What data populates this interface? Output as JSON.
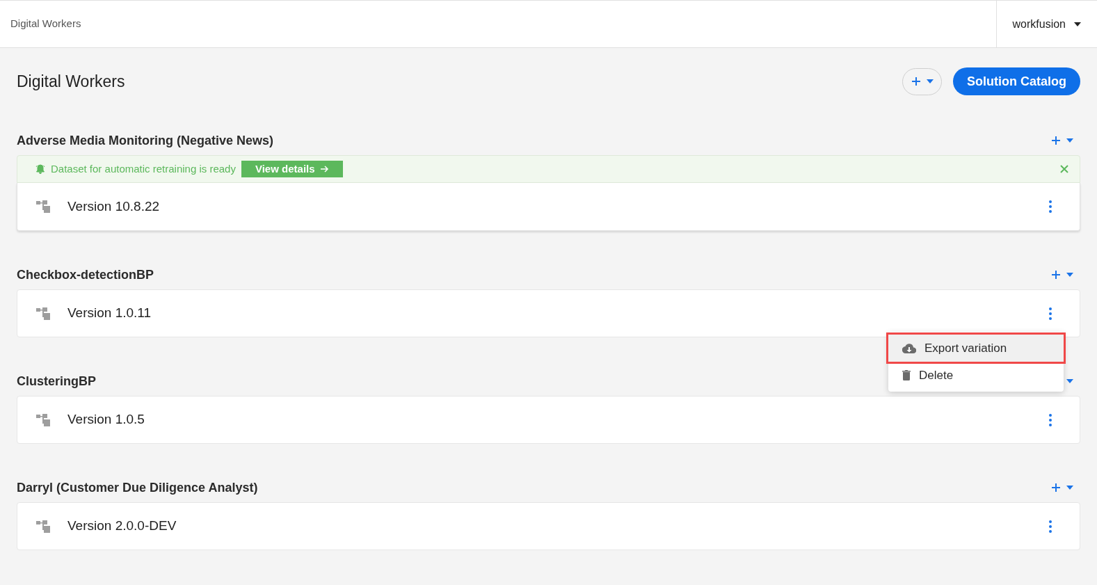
{
  "header": {
    "breadcrumb": "Digital Workers",
    "account": "workfusion"
  },
  "page": {
    "title": "Digital Workers",
    "catalog_button": "Solution Catalog"
  },
  "groups": [
    {
      "name": "Adverse Media Monitoring (Negative News)",
      "banner": {
        "message": "Dataset for automatic retraining is ready",
        "action": "View details"
      },
      "versions": [
        {
          "label": "Version 10.8.22",
          "menu_open": false
        }
      ]
    },
    {
      "name": "Checkbox-detectionBP",
      "versions": [
        {
          "label": "Version 1.0.11",
          "menu_open": true
        }
      ]
    },
    {
      "name": "ClusteringBP",
      "versions": [
        {
          "label": "Version 1.0.5",
          "menu_open": false
        }
      ]
    },
    {
      "name": "Darryl (Customer Due Diligence Analyst)",
      "versions": [
        {
          "label": "Version 2.0.0-DEV",
          "menu_open": false
        }
      ]
    }
  ],
  "menu": {
    "items": [
      {
        "kind": "export",
        "label": "Export variation",
        "highlighted": true
      },
      {
        "kind": "delete",
        "label": "Delete",
        "highlighted": false
      }
    ]
  }
}
